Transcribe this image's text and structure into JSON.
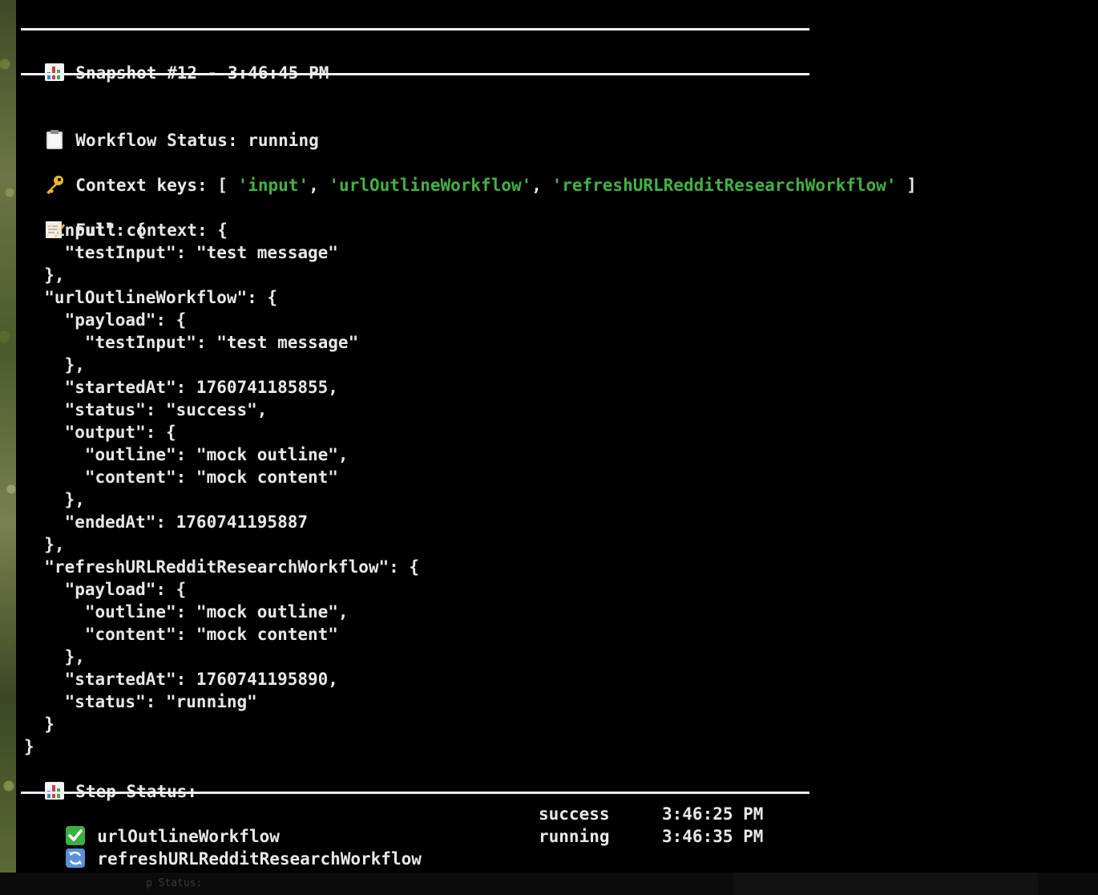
{
  "snapshot": {
    "title": "Snapshot #12 - 3:46:45 PM",
    "icon": "bar-chart-icon"
  },
  "workflow_status": {
    "label": "Workflow Status: running",
    "icon": "clipboard-icon"
  },
  "context_keys": {
    "label": "Context keys: [ ",
    "keys": [
      "'input'",
      "'urlOutlineWorkflow'",
      "'refreshURLRedditResearchWorkflow'"
    ],
    "separator": ", ",
    "close": " ]",
    "icon": "key-icon"
  },
  "full_context": {
    "label": "Full context: {",
    "icon": "memo-icon",
    "body": "  \"input\": {\n    \"testInput\": \"test message\"\n  },\n  \"urlOutlineWorkflow\": {\n    \"payload\": {\n      \"testInput\": \"test message\"\n    },\n    \"startedAt\": 1760741185855,\n    \"status\": \"success\",\n    \"output\": {\n      \"outline\": \"mock outline\",\n      \"content\": \"mock content\"\n    },\n    \"endedAt\": 1760741195887\n  },\n  \"refreshURLRedditResearchWorkflow\": {\n    \"payload\": {\n      \"outline\": \"mock outline\",\n      \"content\": \"mock content\"\n    },\n    \"startedAt\": 1760741195890,\n    \"status\": \"running\"\n  }\n}"
  },
  "step_status": {
    "label": "Step Status:",
    "icon": "bar-chart-icon",
    "steps": [
      {
        "icon": "check-mark-icon",
        "name": "urlOutlineWorkflow",
        "status": "success",
        "time": "3:46:25 PM"
      },
      {
        "icon": "refresh-icon",
        "name": "refreshURLRedditResearchWorkflow",
        "status": "running",
        "time": "3:46:35 PM"
      }
    ]
  },
  "background_ghost_text": "p Status:",
  "colors": {
    "background": "#000000",
    "text": "#e8e8e8",
    "string": "#3fb43f",
    "rule": "#f2f2f2"
  }
}
